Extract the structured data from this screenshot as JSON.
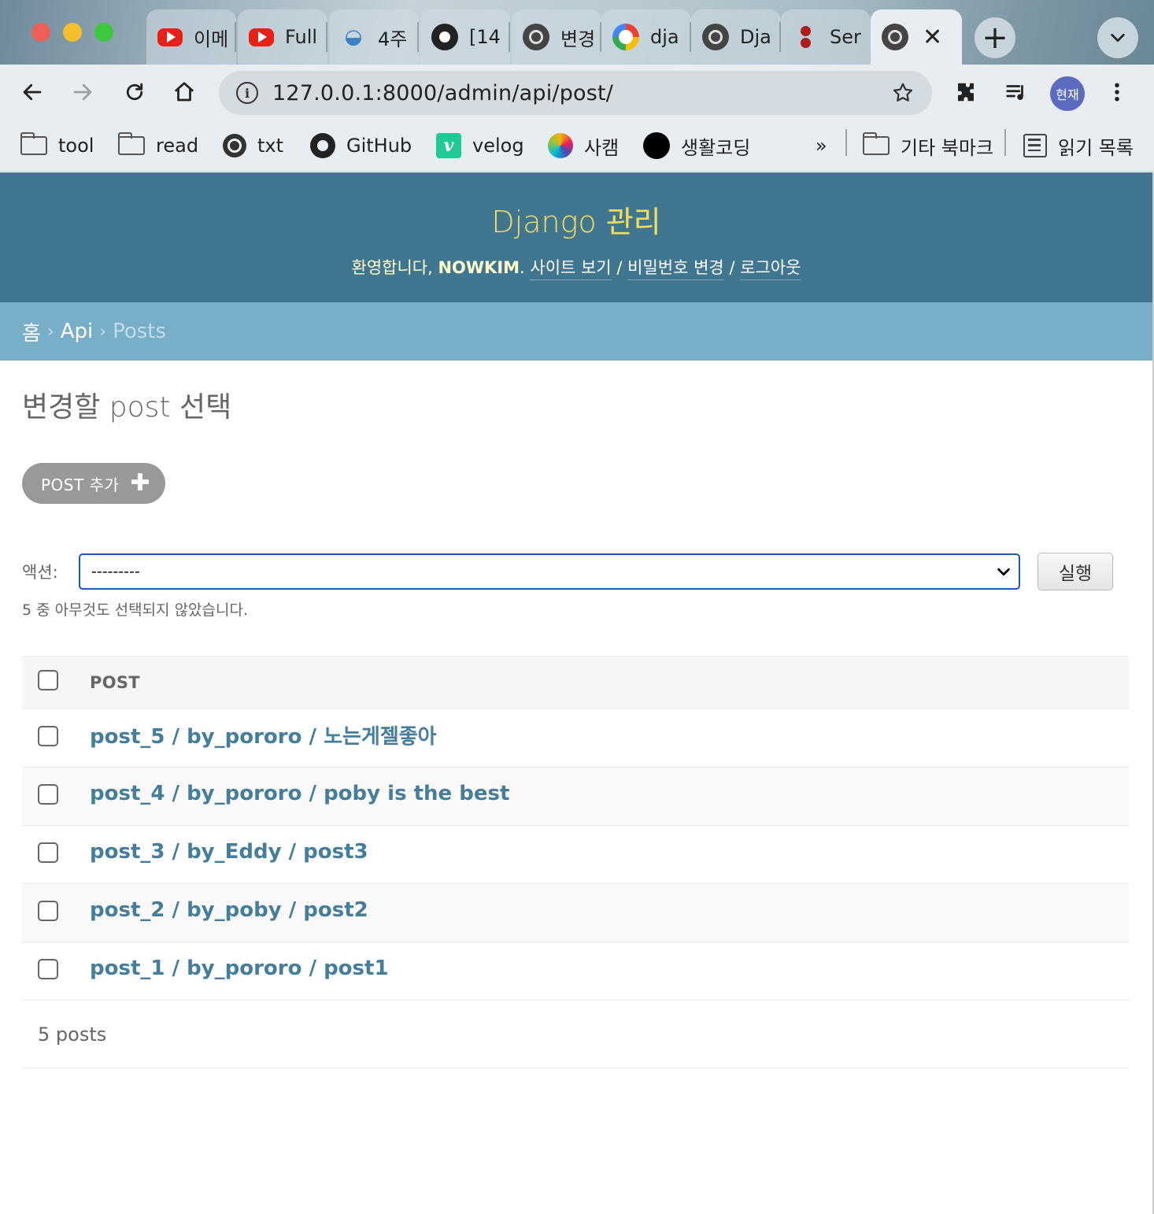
{
  "browser": {
    "tabs": [
      {
        "title": "이메",
        "icon": "youtube-icon"
      },
      {
        "title": "Full",
        "icon": "youtube-icon"
      },
      {
        "title": "4주",
        "icon": "bowl-icon"
      },
      {
        "title": "[14",
        "icon": "github-icon"
      },
      {
        "title": "변경",
        "icon": "globe-icon"
      },
      {
        "title": "dja",
        "icon": "google-icon"
      },
      {
        "title": "Dja",
        "icon": "globe-icon"
      },
      {
        "title": "Ser",
        "icon": "dots-icon"
      }
    ],
    "active_tab_close": "✕",
    "url": "127.0.0.1:8000/admin/api/post/",
    "profile_label": "현재",
    "bookmarks": [
      {
        "label": "tool",
        "icon": "folder-icon"
      },
      {
        "label": "read",
        "icon": "folder-icon"
      },
      {
        "label": "txt",
        "icon": "globe-icon"
      },
      {
        "label": "GitHub",
        "icon": "github-icon"
      },
      {
        "label": "velog",
        "icon": "velog-icon"
      },
      {
        "label": "사캠",
        "icon": "hand-icon"
      },
      {
        "label": "생활코딩",
        "icon": "black-circle-icon"
      }
    ],
    "bookmarks_more": "»",
    "other_bookmarks": "기타 북마크",
    "reading_list": "읽기 목록",
    "velog_letter": "v"
  },
  "admin": {
    "site_name": "Django 관리",
    "welcome": "환영합니다,",
    "username": "NOWKIM",
    "welcome_dot": ".",
    "view_site": "사이트 보기",
    "change_password": "비밀번호 변경",
    "logout": "로그아웃",
    "slash": "/",
    "breadcrumbs": {
      "home": "홈",
      "app": "Api",
      "current": "Posts",
      "sep": "›"
    },
    "page_title": "변경할 post 선택",
    "add_button": "POST 추가",
    "add_plus": "✚",
    "actions_label": "액션:",
    "action_selected": "---------",
    "run_button": "실행",
    "selected_count": "5 중 아무것도 선택되지 않았습니다.",
    "column_header": "POST",
    "rows": [
      "post_5 / by_pororo / 노는게젤좋아",
      "post_4 / by_pororo / poby is the best",
      "post_3 / by_Eddy / post3",
      "post_2 / by_poby / post2",
      "post_1 / by_pororo / post1"
    ],
    "paginator": "5 posts"
  },
  "colors": {
    "header_bg": "#417690",
    "site_name": "#f5dd5d",
    "breadcrumbs_bg": "#79aec8",
    "link": "#447e9b",
    "select_border": "#1a5bb8"
  }
}
